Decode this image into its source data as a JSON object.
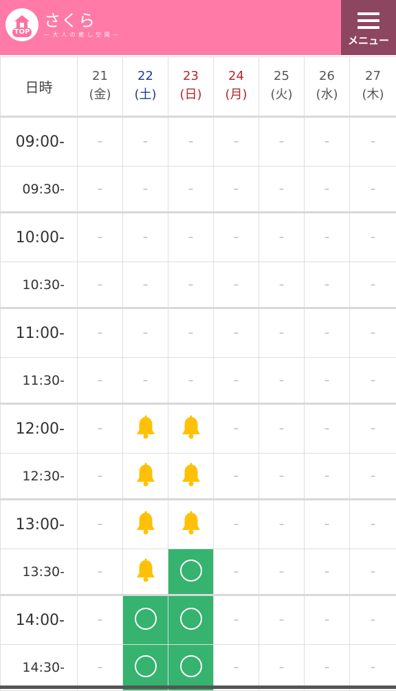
{
  "header": {
    "top_label": "TOP",
    "brand_name": "さくら",
    "brand_sub": "— 大 人 の 癒 し 空 間 —",
    "menu_label": "メニュー",
    "colors": {
      "header_bg": "#ff7aa6",
      "menu_bg": "#8d4660"
    }
  },
  "table": {
    "corner_label": "日時",
    "days": [
      {
        "num": "21",
        "weekday": "(金)",
        "tone": "weekday"
      },
      {
        "num": "22",
        "weekday": "(土)",
        "tone": "sat"
      },
      {
        "num": "23",
        "weekday": "(日)",
        "tone": "sun"
      },
      {
        "num": "24",
        "weekday": "(月)",
        "tone": "sun"
      },
      {
        "num": "25",
        "weekday": "(火)",
        "tone": "weekday"
      },
      {
        "num": "26",
        "weekday": "(水)",
        "tone": "weekday"
      },
      {
        "num": "27",
        "weekday": "(木)",
        "tone": "weekday"
      }
    ],
    "empty_mark": "–",
    "rows": [
      {
        "time": "09:00-",
        "kind": "hour",
        "slots": [
          "-",
          "-",
          "-",
          "-",
          "-",
          "-",
          "-"
        ]
      },
      {
        "time": "09:30-",
        "kind": "half",
        "slots": [
          "-",
          "-",
          "-",
          "-",
          "-",
          "-",
          "-"
        ]
      },
      {
        "time": "10:00-",
        "kind": "hour",
        "slots": [
          "-",
          "-",
          "-",
          "-",
          "-",
          "-",
          "-"
        ]
      },
      {
        "time": "10:30-",
        "kind": "half",
        "slots": [
          "-",
          "-",
          "-",
          "-",
          "-",
          "-",
          "-"
        ]
      },
      {
        "time": "11:00-",
        "kind": "hour",
        "slots": [
          "-",
          "-",
          "-",
          "-",
          "-",
          "-",
          "-"
        ]
      },
      {
        "time": "11:30-",
        "kind": "half",
        "slots": [
          "-",
          "-",
          "-",
          "-",
          "-",
          "-",
          "-"
        ]
      },
      {
        "time": "12:00-",
        "kind": "hour",
        "slots": [
          "-",
          "bell",
          "bell",
          "-",
          "-",
          "-",
          "-"
        ]
      },
      {
        "time": "12:30-",
        "kind": "half",
        "slots": [
          "-",
          "bell",
          "bell",
          "-",
          "-",
          "-",
          "-"
        ]
      },
      {
        "time": "13:00-",
        "kind": "hour",
        "slots": [
          "-",
          "bell",
          "bell",
          "-",
          "-",
          "-",
          "-"
        ]
      },
      {
        "time": "13:30-",
        "kind": "half",
        "slots": [
          "-",
          "bell",
          "open",
          "-",
          "-",
          "-",
          "-"
        ]
      },
      {
        "time": "14:00-",
        "kind": "hour",
        "slots": [
          "-",
          "open",
          "open",
          "-",
          "-",
          "-",
          "-"
        ]
      },
      {
        "time": "14:30-",
        "kind": "half",
        "slots": [
          "-",
          "open",
          "open",
          "-",
          "-",
          "-",
          "-"
        ]
      }
    ],
    "colors": {
      "open_bg": "#35b36f",
      "bell": "#ffc107",
      "sat": "#213a86",
      "sun": "#b3262b"
    }
  }
}
